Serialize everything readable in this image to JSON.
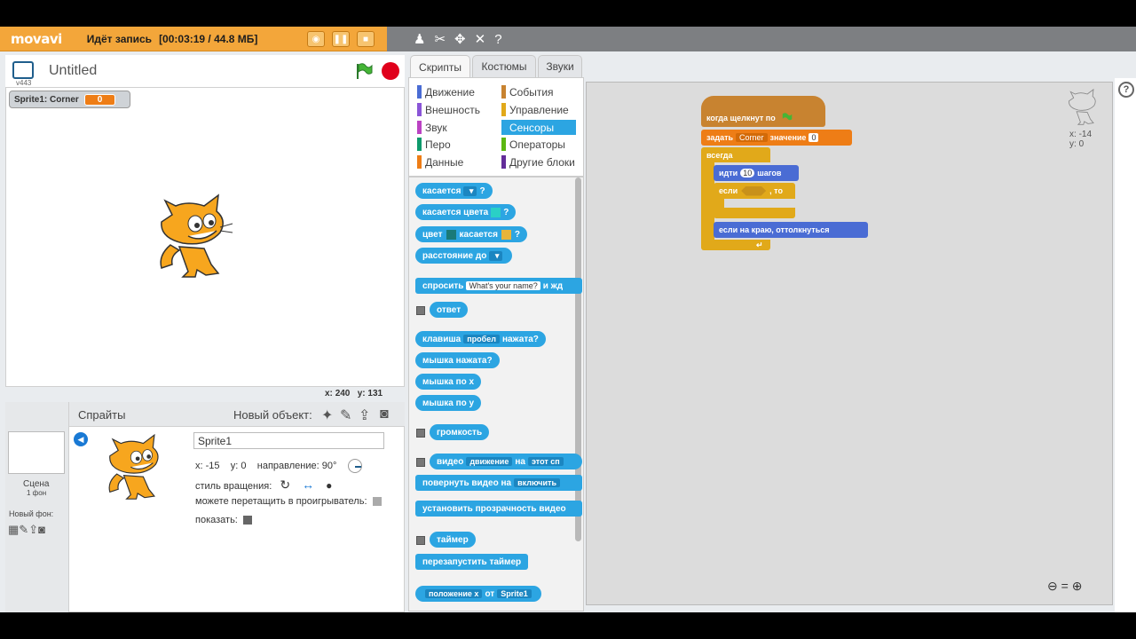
{
  "recorder": {
    "logo": "movavi",
    "status": "Идёт запись",
    "time": "[00:03:19 / 44.8 МБ]"
  },
  "editor": {
    "title": "Untitled",
    "version": "v443"
  },
  "stage": {
    "monitor_label": "Sprite1: Corner",
    "monitor_value": "0",
    "coords_x_label": "x:",
    "coords_x": "240",
    "coords_y_label": "y:",
    "coords_y": "131"
  },
  "sprites_panel": {
    "title": "Спрайты",
    "new_object": "Новый объект:",
    "scene_label": "Сцена",
    "scene_bg": "1 фон",
    "new_bg_label": "Новый фон:",
    "sprite_name": "Sprite1",
    "x_label": "x:",
    "x_value": "-15",
    "y_label": "y:",
    "y_value": "0",
    "direction_label": "направление:",
    "direction_value": "90°",
    "rotation_label": "стиль вращения:",
    "drag_label": "можете перетащить в проигрыватель:",
    "show_label": "показать:"
  },
  "tabs": [
    "Скрипты",
    "Костюмы",
    "Звуки"
  ],
  "categories": {
    "left": [
      {
        "label": "Движение",
        "color": "#4a6cd4"
      },
      {
        "label": "Внешность",
        "color": "#8a55d7"
      },
      {
        "label": "Звук",
        "color": "#bb42c3"
      },
      {
        "label": "Перо",
        "color": "#0e9a6c"
      },
      {
        "label": "Данные",
        "color": "#ee7d16"
      }
    ],
    "right": [
      {
        "label": "События",
        "color": "#c88330"
      },
      {
        "label": "Управление",
        "color": "#e1a91a"
      },
      {
        "label": "Сенсоры",
        "color": "#2ca5e2"
      },
      {
        "label": "Операторы",
        "color": "#5cb712"
      },
      {
        "label": "Другие блоки",
        "color": "#632d99"
      }
    ]
  },
  "palette": {
    "touching": "касается",
    "touching_color": "касается цвета",
    "color": "цвет",
    "color_touching": "касается",
    "q": "?",
    "distance": "расстояние до",
    "ask": "спросить",
    "ask_default": "What's your name?",
    "ask_suffix": "и жд",
    "answer": "ответ",
    "key": "клавиша",
    "key_value": "пробел",
    "key_suffix": "нажата?",
    "mouse_down": "мышка нажата?",
    "mouse_x": "мышка по x",
    "mouse_y": "мышка по y",
    "loudness": "громкость",
    "video": "видео",
    "video_attr": "движение",
    "video_on": "на",
    "video_target": "этот сп",
    "turn_video": "повернуть видео на",
    "turn_video_value": "включить",
    "transparency": "установить прозрачность видео",
    "timer": "таймер",
    "reset_timer": "перезапустить таймер",
    "attr": "положение x",
    "attr_of": "от",
    "attr_target": "Sprite1"
  },
  "script": {
    "hat": "когда щелкнут по",
    "set": "задать",
    "set_var": "Corner",
    "set_value_label": "значение",
    "set_value": "0",
    "forever": "всегда",
    "move": "идти",
    "move_steps": "10",
    "move_suffix": "шагов",
    "if": "если",
    "then": ", то",
    "bounce": "если на краю, оттолкнуться",
    "sprite_x_label": "x:",
    "sprite_x": "-14",
    "sprite_y_label": "y:",
    "sprite_y": "0"
  },
  "colors": {
    "sensing": "#2ca5e2",
    "control": "#e1a91a",
    "motion": "#4a6cd4",
    "events": "#c88330",
    "data": "#ee7d16",
    "recorder": "#f3a63a"
  }
}
